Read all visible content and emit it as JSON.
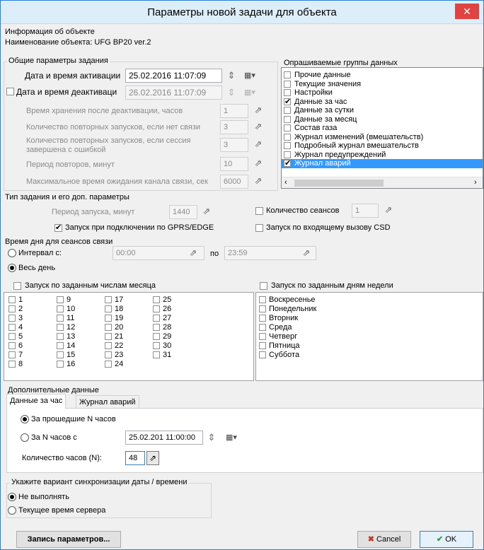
{
  "window": {
    "title": "Параметры новой задачи для объекта",
    "close_glyph": "✕"
  },
  "object_info": {
    "header": "Информация об объекте",
    "name": "Наименование объекта: UFG BP20 ver.2"
  },
  "general": {
    "header": "Общие параметры задания",
    "activation_label": "Дата и время активации",
    "activation_value": "25.02.2016     11:07:09",
    "deactivation_label": "Дата и время деактиваци",
    "deactivation_value": "26.02.2016     11:07:09",
    "deactivation_checked": false,
    "storage_label": "Время хранения после деактивации, часов",
    "storage_value": "1",
    "retry_no_link_label": "Количество повторных запусков, если нет связи",
    "retry_no_link_value": "3",
    "retry_error_label1": "Количество повторных запусков, если сессия",
    "retry_error_label2": "завершена с ошибкой",
    "retry_error_value": "3",
    "retry_period_label": "Период повторов, минут",
    "retry_period_value": "10",
    "wait_label": "Максимальное время ожидания канала связи, сек",
    "wait_value": "6000"
  },
  "groups": {
    "header": "Опрашиваемые группы данных",
    "items": [
      {
        "label": "Прочие данные",
        "checked": false
      },
      {
        "label": "Текущие значения",
        "checked": false
      },
      {
        "label": "Настройки",
        "checked": false
      },
      {
        "label": "Данные за час",
        "checked": true
      },
      {
        "label": "Данные за сутки",
        "checked": false
      },
      {
        "label": "Данные за месяц",
        "checked": false
      },
      {
        "label": "Состав газа",
        "checked": false
      },
      {
        "label": "Журнал изменений (вмешательств)",
        "checked": false
      },
      {
        "label": "Подробный журнал вмешательств",
        "checked": false
      },
      {
        "label": "Журнал предупреждений",
        "checked": false
      },
      {
        "label": "Журнал аварий",
        "checked": true,
        "selected": true
      }
    ]
  },
  "task_type": {
    "header": "Тип задания и его доп. параметры",
    "period_label": "Период запуска, минут",
    "period_value": "1440",
    "sessions_label": "Количество сеансов",
    "sessions_value": "1",
    "gprs_label": "Запуск при подключении по GPRS/EDGE",
    "csd_label": "Запуск по входящему вызову CSD"
  },
  "time_of_day": {
    "header": "Время дня для сеансов связи",
    "interval_label": "Интервал с:",
    "from_value": "00:00",
    "to_label": "по",
    "to_value": "23:59",
    "all_day_label": "Весь день"
  },
  "month_days": {
    "header": "Запуск по заданным числам месяца",
    "days": [
      "1",
      "2",
      "3",
      "4",
      "5",
      "6",
      "7",
      "8",
      "9",
      "10",
      "11",
      "12",
      "13",
      "14",
      "15",
      "16",
      "17",
      "18",
      "19",
      "20",
      "21",
      "22",
      "23",
      "24",
      "25",
      "26",
      "27",
      "28",
      "29",
      "30",
      "31"
    ]
  },
  "week_days": {
    "header": "Запуск по заданным дням недели",
    "days": [
      "Воскресенье",
      "Понедельник",
      "Вторник",
      "Среда",
      "Четверг",
      "Пятница",
      "Суббота"
    ]
  },
  "extra": {
    "header": "Дополнительные данные",
    "tabs": [
      "Данные за час",
      "Журнал аварий"
    ],
    "last_n_label": "За прошедшие N часов",
    "n_from_label": "За N часов с",
    "n_from_value": "25.02.201 11:00:00",
    "count_label": "Количество часов (N):",
    "count_value": "48"
  },
  "sync": {
    "header": "Укажите вариант синхронизации даты / времени",
    "none_label": "Не выполнять",
    "server_label": "Текущее время сервера"
  },
  "footer": {
    "save_label": "Запись параметров...",
    "cancel_label": "Cancel",
    "ok_label": "OK"
  }
}
